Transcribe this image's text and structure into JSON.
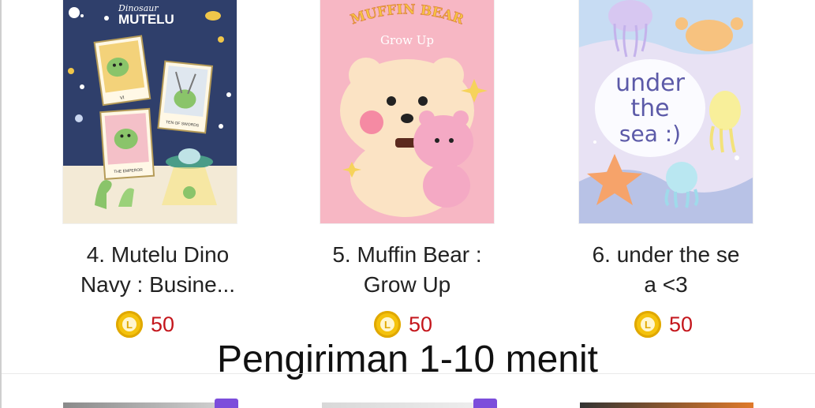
{
  "products": [
    {
      "title_line1": "4. Mutelu Dino",
      "title_line2": "Navy : Busine...",
      "price": "50",
      "coin_letter": "L",
      "thumbnail_text": {
        "script": "Dinosaur",
        "brand": "MUTELU",
        "card1": "VI",
        "card2": "TEN OF SWORDS",
        "card3": "THE EMPEROR"
      },
      "colors": {
        "bg": "#2f3f6b",
        "accent": "#8ac46a"
      }
    },
    {
      "title_line1": "5. Muffin Bear :",
      "title_line2": "Grow Up",
      "price": "50",
      "coin_letter": "L",
      "thumbnail_text": {
        "brand": "MUFFIN BEAR",
        "sub": "Grow Up"
      },
      "colors": {
        "bg": "#f7b7c4",
        "accent": "#fbe3c4"
      }
    },
    {
      "title_line1": "6. under the se",
      "title_line2": "a <3",
      "price": "50",
      "coin_letter": "L",
      "thumbnail_text": {
        "line1": "under",
        "line2": "the",
        "line3": "sea :)"
      },
      "colors": {
        "bg": "#e8e2f4",
        "accent": "#5c5aa8"
      }
    }
  ],
  "banner": "Pengiriman 1-10 menit",
  "colors": {
    "coin": "#f4c20d",
    "price": "#c4161c",
    "tag": "#7c4ddb"
  }
}
